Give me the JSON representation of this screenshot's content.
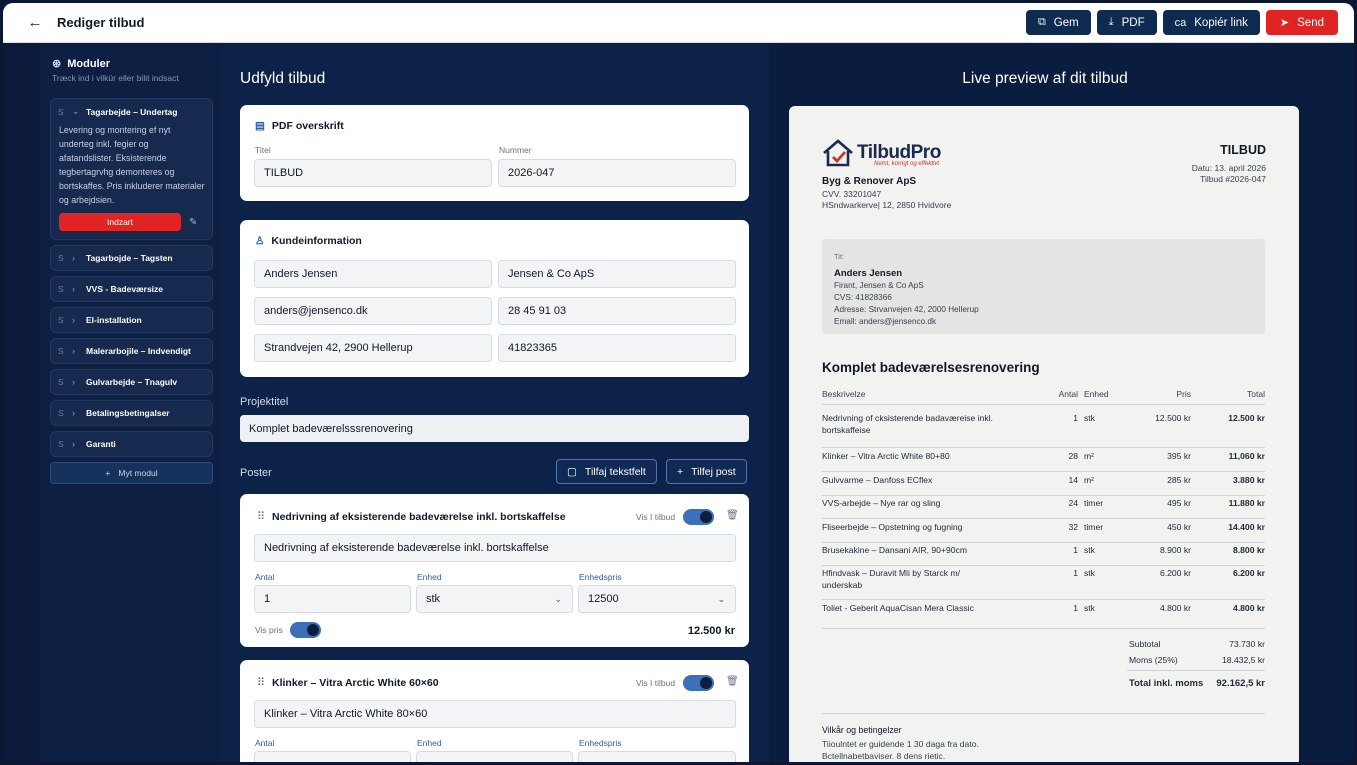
{
  "header": {
    "title": "Rediger tilbud",
    "actions": {
      "save": "Gem",
      "pdf": "PDF",
      "copy_prefix": "ca",
      "copy": "Kopiér link",
      "send": "Send"
    }
  },
  "sidebar": {
    "title": "Moduler",
    "subtitle": "Træck ind i vilkür eller bilit indsact",
    "open_module": {
      "grip": "S",
      "label": "Tagarbejde – Undertag",
      "description": "Levering og montering ef nyt underteg inkl. fegier og afatandslister. Eksisterende tegbertagrvhg demonteres og bortskaffes. Pris inkluderer materialer og arbejdsien.",
      "insert_label": "Indzart"
    },
    "modules": [
      {
        "grip": "S",
        "label": "Tagarbojde – Tagsten"
      },
      {
        "grip": "S",
        "label": "VVS - Badeværsize"
      },
      {
        "grip": "S",
        "label": "El-installation"
      },
      {
        "grip": "S",
        "label": "Malerarbojile – Indvendigt"
      },
      {
        "grip": "S",
        "label": "Gulvarbejde – Tnagulv"
      },
      {
        "grip": "S",
        "label": "Betalingsbetingalser"
      },
      {
        "grip": "S",
        "label": "Garanti"
      }
    ],
    "my_module": "Myt modul"
  },
  "form": {
    "title": "Udfyld tilbud",
    "pdf_header": {
      "title": "PDF overskrift",
      "title_label": "Titel",
      "title_value": "TILBUD",
      "number_label": "Nummer",
      "number_value": "2026-047"
    },
    "customer": {
      "title": "Kundeinformation",
      "name": "Anders Jensen",
      "company": "Jensen & Co ApS",
      "email": "anders@jensenco.dk",
      "phone": "28 45 91 03",
      "address": "Strandvejen 42, 2900 Hellerup",
      "cvr": "41823365"
    },
    "project_label": "Projektitel",
    "project_value": "Komplet badeværelsssrenovering",
    "posts_label": "Poster",
    "add_text": "Tilfaj tekstfelt",
    "add_post": "Tilfej post",
    "posts": [
      {
        "title": "Nedrivning af eksisterende badeværelse inkl. bortskaffelse",
        "show_label": "Vis I tilbud",
        "description": "Nedrivning af eksisterende badeværelse inkl. bortskaffelse",
        "qty_label": "Antal",
        "qty": "1",
        "unit_label": "Enhed",
        "unit": "stk",
        "price_label": "Enhedspris",
        "price": "12500",
        "show_price_label": "Vis pris",
        "total": "12.500 kr"
      },
      {
        "title": "Klinker – Vitra Arctic White 60×60",
        "show_label": "Vis I tilbud",
        "description": "Klinker – Vitra Arctic White 80×60",
        "qty_label": "Antal",
        "unit_label": "Enhed",
        "price_label": "Enhedspris"
      }
    ]
  },
  "preview": {
    "title": "Live preview af dit tilbud",
    "logo": "TilbudPro",
    "logo_tagline": "Nemt, korrigt og effektivt",
    "company": {
      "name": "Byg & Renover ApS",
      "cvr": "CVV. 33201047",
      "address": "HSndwarkerve| 12, 2850 Hvidvore"
    },
    "doc_title": "TILBUD",
    "date": "Datu: 13. april 2026",
    "number": "Tilbud #2026-047",
    "to": {
      "label": "Tit:",
      "name": "Anders Jensen",
      "company": "Firant, Jensen & Co ApS",
      "cvr": "CVS: 41828366",
      "address": "Adresse: Strvanvejen 42, 2000 Hellerup",
      "email": "Emall: anders@jensenco.dk"
    },
    "project": "Komplet badeværelsesrenovering",
    "columns": [
      "Beskrivelze",
      "Antal",
      "Enhed",
      "Pris",
      "Total"
    ],
    "rows": [
      {
        "desc": "Nedrivning of cksisterende badaværeise inkl. bortskaffeise",
        "qty": "1",
        "unit": "stk",
        "price": "12.500 kr",
        "total": "12.500 kr"
      },
      {
        "desc": "Klinker – Vitra Arctic White 80+80",
        "qty": "28",
        "unit": "m²",
        "price": "395 kr",
        "total": "11,060 kr"
      },
      {
        "desc": "Gulvvarme – Danfoss ECflex",
        "qty": "14",
        "unit": "m²",
        "price": "285 kr",
        "total": "3.880 kr"
      },
      {
        "desc": "VVS-arbejde – Nye rar og sling",
        "qty": "24",
        "unit": "timer",
        "price": "495 kr",
        "total": "11.880 kr"
      },
      {
        "desc": "Fliseerbejde – Opstetning og fugning",
        "qty": "32",
        "unit": "timer",
        "price": "450 kr",
        "total": "14.400 kr"
      },
      {
        "desc": "Brusekakine – Dansani AIR, 90+90cm",
        "qty": "1",
        "unit": "stk",
        "price": "8.900 kr",
        "total": "8.800 kr"
      },
      {
        "desc": "Hfindvask – Duravit Mli by Starck m/ underskab",
        "qty": "1",
        "unit": "stk",
        "price": "6.200 kr",
        "total": "6.200 kr"
      },
      {
        "desc": "Toliet - Geberit AquaCisan Mera Classic",
        "qty": "1",
        "unit": "stk",
        "price": "4.800 kr",
        "total": "4.800 kr"
      }
    ],
    "subtotal_label": "Subtotal",
    "subtotal": "73.730 kr",
    "vat_label": "Moms (25%)",
    "vat": "18.432,5 kr",
    "grand_label": "Total inkl. moms",
    "grand": "92.162,5 kr",
    "terms_title": "Vilkår og betingelzer",
    "terms_1": "Tiioulntet er guidende 1 30 daga fra dato.",
    "terms_2": "Bctellnabetbaviser. 8 dens rietic."
  }
}
